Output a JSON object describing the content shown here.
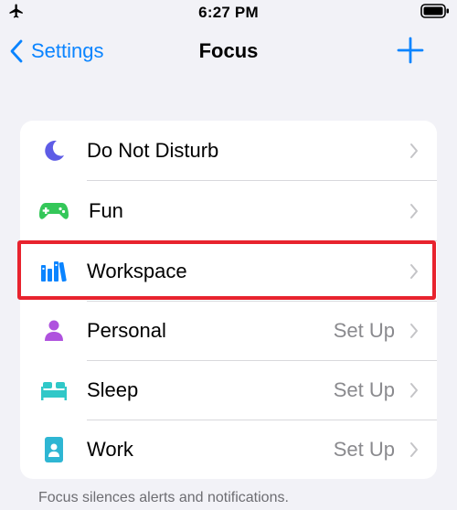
{
  "status_bar": {
    "time": "6:27 PM"
  },
  "nav": {
    "back_label": "Settings",
    "title": "Focus"
  },
  "focus_items": [
    {
      "label": "Do Not Disturb",
      "detail": "",
      "icon": "moon-icon",
      "color": "#5e5ce6"
    },
    {
      "label": "Fun",
      "detail": "",
      "icon": "game-controller-icon",
      "color": "#34c759"
    },
    {
      "label": "Workspace",
      "detail": "",
      "icon": "books-icon",
      "color": "#0a84ff",
      "highlighted": true
    },
    {
      "label": "Personal",
      "detail": "Set Up",
      "icon": "person-icon",
      "color": "#af52de"
    },
    {
      "label": "Sleep",
      "detail": "Set Up",
      "icon": "bed-icon",
      "color": "#30c8c8"
    },
    {
      "label": "Work",
      "detail": "Set Up",
      "icon": "id-badge-icon",
      "color": "#2eb6d3"
    }
  ],
  "footer_note": "Focus silences alerts and notifications."
}
